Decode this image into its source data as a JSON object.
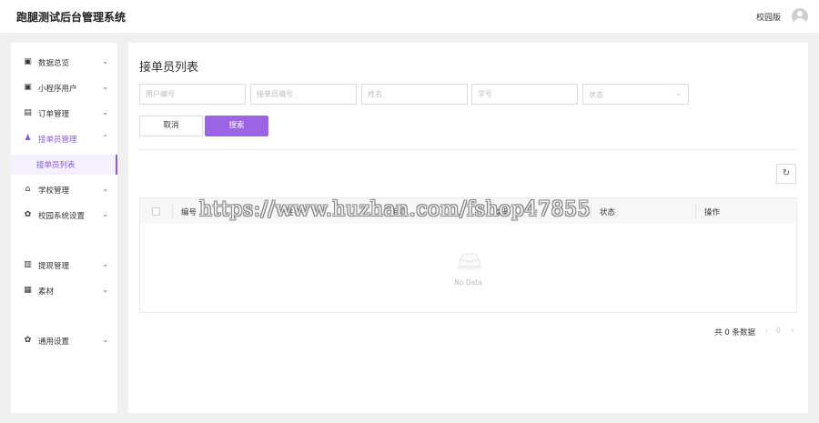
{
  "app": {
    "title": "跑腿测试后台管理系统",
    "campus_label": "校园版"
  },
  "sidebar": {
    "items": [
      {
        "label": "数据总览",
        "icon": "dashboard-icon"
      },
      {
        "label": "小程序用户",
        "icon": "users-icon"
      },
      {
        "label": "订单管理",
        "icon": "order-icon"
      },
      {
        "label": "接单员管理",
        "icon": "courier-icon"
      },
      {
        "label": "学校管理",
        "icon": "school-icon"
      },
      {
        "label": "校园系统设置",
        "icon": "gear-icon"
      },
      {
        "label": "提现管理",
        "icon": "withdraw-icon"
      },
      {
        "label": "素材",
        "icon": "material-icon"
      },
      {
        "label": "通用设置",
        "icon": "gear-icon"
      }
    ],
    "submenu": {
      "label": "接单员列表"
    },
    "accent": "#8a57e0"
  },
  "main": {
    "title": "接单员列表",
    "filters": {
      "user_id_placeholder": "用户编号",
      "courier_id_placeholder": "接单员编号",
      "name_placeholder": "姓名",
      "student_id_placeholder": "学号",
      "status_placeholder": "状态"
    },
    "buttons": {
      "cancel": "取消",
      "search": "搜索",
      "search_color": "#9d63e6"
    },
    "table": {
      "columns": [
        "编号",
        "姓名",
        "手机",
        "学号",
        "状态",
        "操作"
      ],
      "rows": [],
      "empty_text": "No Data"
    },
    "pagination": {
      "total": "共 0 条数据",
      "current": "0"
    }
  },
  "watermark": "https://www.huzhan.com/fshop47855"
}
